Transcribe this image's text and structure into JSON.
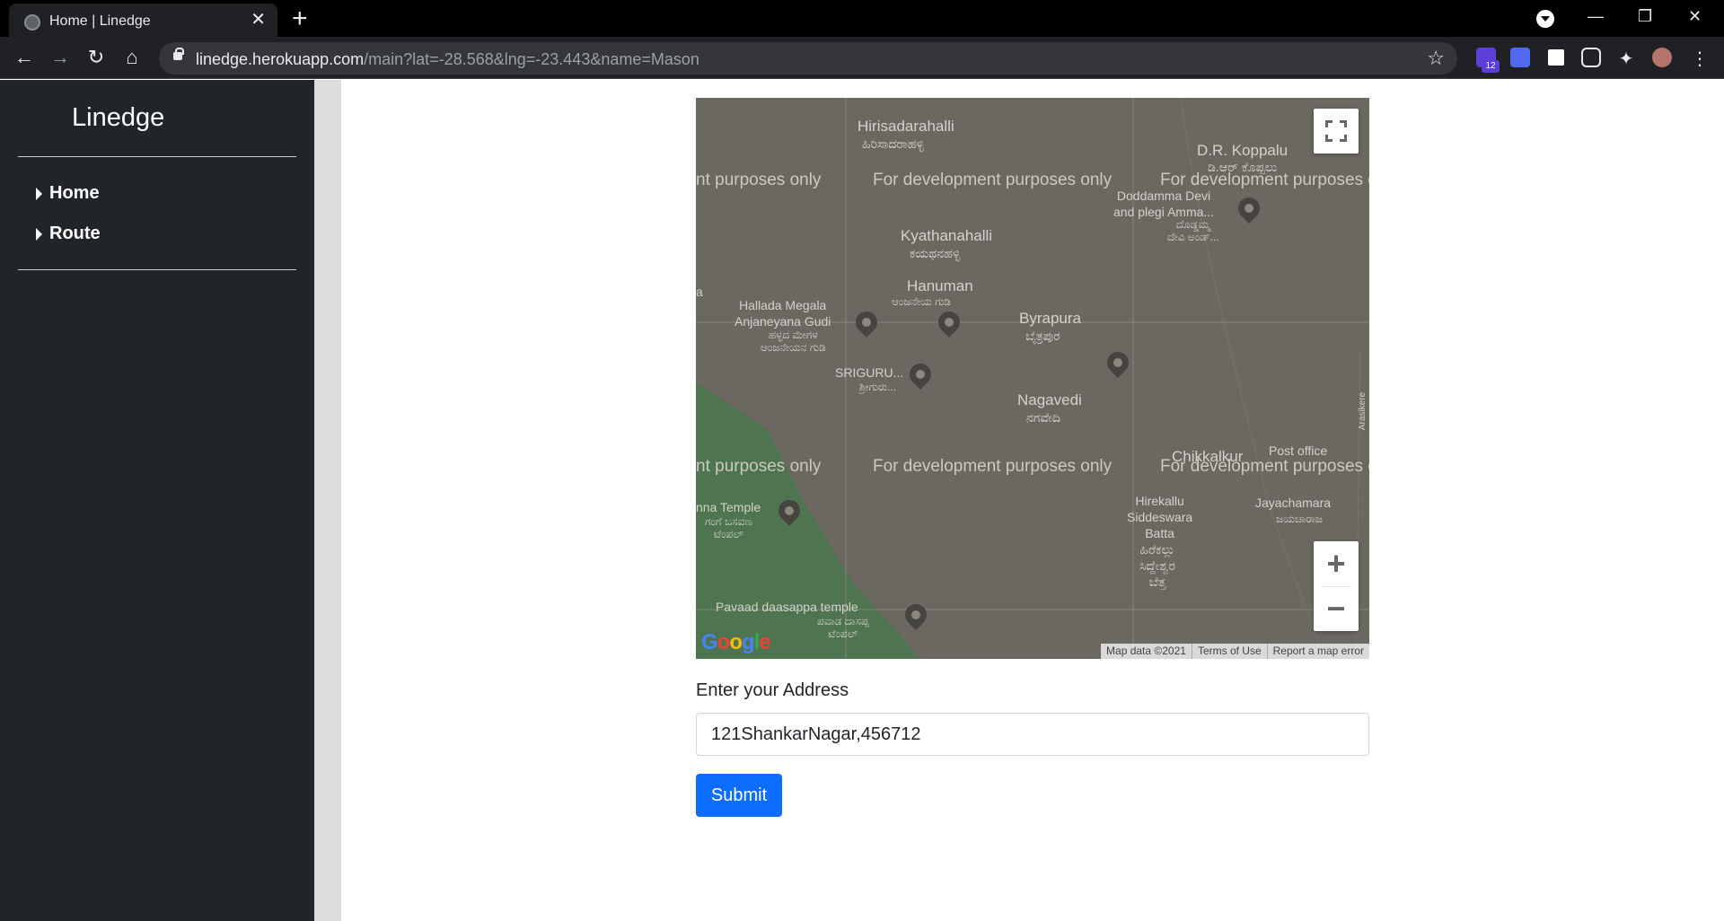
{
  "browser": {
    "tab_title": "Home | Linedge",
    "url_host": "linedge.herokuapp.com",
    "url_path": "/main?lat=-28.568&lng=-23.443&name=Mason",
    "extension_badge": "12"
  },
  "sidebar": {
    "brand": "Linedge",
    "items": [
      {
        "label": "Home"
      },
      {
        "label": "Route"
      }
    ]
  },
  "map": {
    "watermark": "For development purposes only",
    "watermark_left": "nt purposes only",
    "watermark_right": "For development purposes o",
    "places": {
      "hirisadarahalli": "Hirisadarahalli",
      "hirisadarahalli_kn": "ಹಿರಿಸಾದರಾಹಳ್ಳಿ",
      "dr_koppalu": "D.R. Koppalu",
      "dr_koppalu_kn": "ಡಿ.ಆರ್ ಕೊಪ್ಪಲು",
      "doddamma": "Doddamma Devi\nand plegi Amma...",
      "doddamma_kn": "ದೊಡ್ಡಮ್ಮ\nದೇವಿ ಅಂಡ್...",
      "kyathanahalli": "Kyathanahalli",
      "kyathanahalli_kn": "ಕಯಥನಹಳ್ಳಿ",
      "hanuman": "Hanuman",
      "hanuman_kn": "ಆಂಜನೇಯ ಗುಡಿ",
      "hallada": "Hallada Megala\nAnjaneyana Gudi",
      "hallada_kn": "ಹಳ್ಳದ ಮೇಗಳ\nಆಂಜನೇಯನ ಗುಡಿ",
      "byrapura": "Byrapura",
      "byrapura_kn": "ಬೈತ್ರಪುರ",
      "sriguru": "SRIGURU...",
      "sriguru_kn": "ಶ್ರೀಗುರು...",
      "nagavedi": "Nagavedi",
      "nagavedi_kn": "ನಗವೇದಿ",
      "chikkalkur": "Chikkalkur",
      "post_office": "Post office",
      "hirekallu": "Hirekallu\nSiddeswara\nBatta",
      "hirekallu_kn": "ಹಿರೆಕಲ್ಲು\nಸಿದ್ದೇಶ್ವರ\nಬೆತ್ತ",
      "jayachamara": "Jayachamara",
      "jayachamara_kn": "ಜಯಚಾರಾಜ",
      "temple_left": "nna Temple",
      "temple_left_kn": "ಗಂಗೆ ಬಸವಣ\nಟೆಂಪಲ್",
      "pavaad": "Pavaad daasappa temple",
      "pavaad_kn": "ಪವಾಡ ದಾಸಪ್ಪ\nಟೆಂಪಲ್",
      "edge_a": "a",
      "arasikere": "Arasikere"
    },
    "zoom_in": "+",
    "zoom_out": "−",
    "attribution": [
      "Map data ©2021",
      "Terms of Use",
      "Report a map error"
    ]
  },
  "form": {
    "label": "Enter your Address",
    "address_value": "121ShankarNagar,456712",
    "submit_label": "Submit"
  }
}
